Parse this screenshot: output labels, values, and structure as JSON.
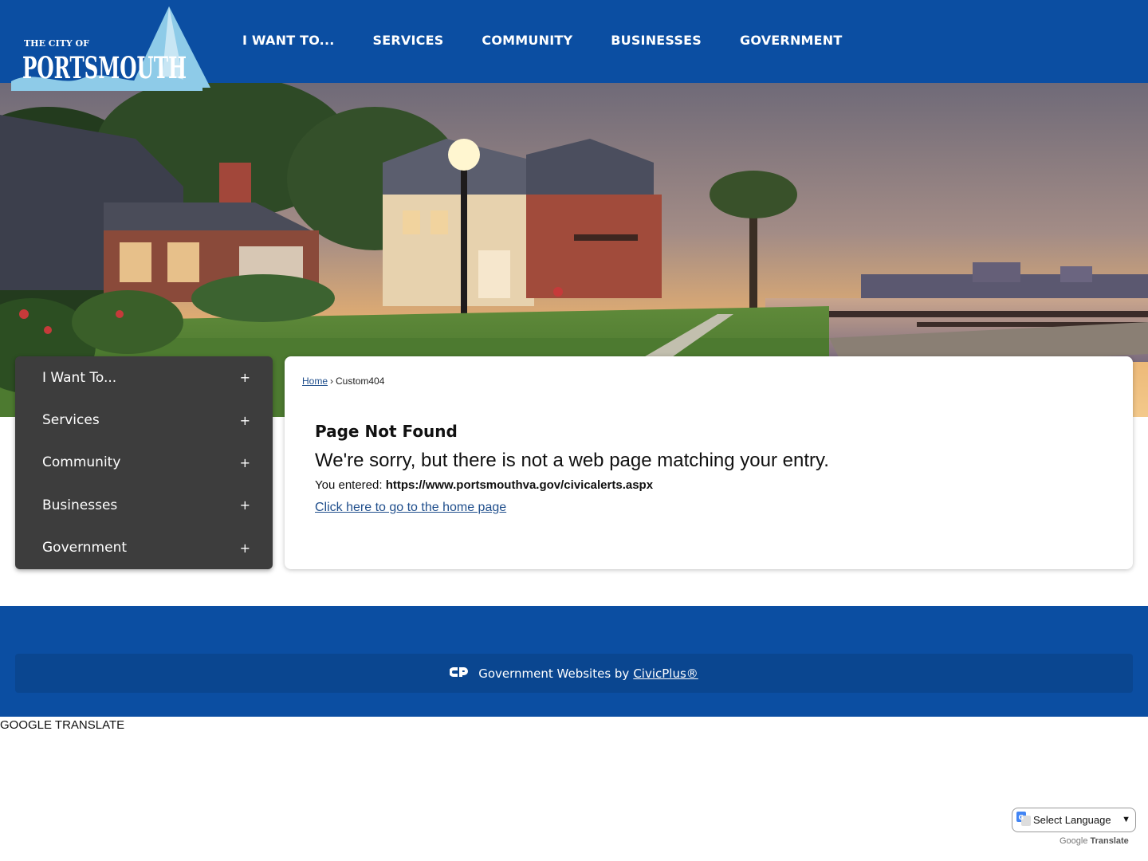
{
  "header": {
    "logo_text_small": "THE CITY OF",
    "logo_text_big": "PORTSMOUTH",
    "nav": [
      "I WANT TO...",
      "SERVICES",
      "COMMUNITY",
      "BUSINESSES",
      "GOVERNMENT"
    ]
  },
  "sidebar": {
    "items": [
      {
        "label": "I Want To...",
        "expand": "+"
      },
      {
        "label": "Services",
        "expand": "+"
      },
      {
        "label": "Community",
        "expand": "+"
      },
      {
        "label": "Businesses",
        "expand": "+"
      },
      {
        "label": "Government",
        "expand": "+"
      }
    ]
  },
  "breadcrumb": {
    "home": "Home",
    "separator": "›",
    "current": "Custom404"
  },
  "content": {
    "title": "Page Not Found",
    "message": "We're sorry, but there is not a web page matching your entry.",
    "entered_label": "You entered:",
    "entered_url": "https://www.portsmouthva.gov/civicalerts.aspx",
    "home_link": "Click here to go to the home page"
  },
  "footer": {
    "text": "Government Websites by",
    "link": "CivicPlus®"
  },
  "google_translate": {
    "label": "GOOGLE TRANSLATE",
    "select_value": "Select Language",
    "powered_by": "Google",
    "translate_word": "Translate"
  },
  "colors": {
    "brand_blue": "#0b4ea2",
    "menu_gray": "#3d3d3d",
    "link_blue": "#1f4e8c"
  }
}
